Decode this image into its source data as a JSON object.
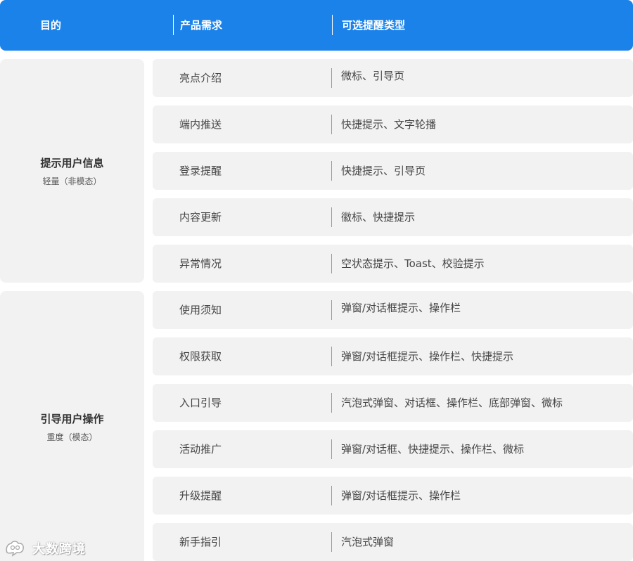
{
  "header": {
    "col1": "目的",
    "col2": "产品需求",
    "col3": "可选提醒类型"
  },
  "groups": [
    {
      "title": "提示用户信息",
      "subtitle": "轻量（非模态）",
      "rows": [
        {
          "need": "亮点介绍",
          "types": "微标、引导页"
        },
        {
          "need": "端内推送",
          "types": "快捷提示、文字轮播"
        },
        {
          "need": "登录提醒",
          "types": "快捷提示、引导页"
        },
        {
          "need": "内容更新",
          "types": "徽标、快捷提示"
        },
        {
          "need": "异常情况",
          "types": "空状态提示、Toast、校验提示"
        }
      ]
    },
    {
      "title": "引导用户操作",
      "subtitle": "重度（模态）",
      "rows": [
        {
          "need": "使用须知",
          "types": "弹窗/对话框提示、操作栏"
        },
        {
          "need": "权限获取",
          "types": "弹窗/对话框提示、操作栏、快捷提示"
        },
        {
          "need": "入口引导",
          "types": "汽泡式弹窗、对话框、操作栏、底部弹窗、微标"
        },
        {
          "need": "活动推广",
          "types": "弹窗/对话框、快捷提示、操作栏、微标"
        },
        {
          "need": "升级提醒",
          "types": "弹窗/对话框提示、操作栏"
        },
        {
          "need": "新手指引",
          "types": "汽泡式弹窗"
        }
      ]
    }
  ],
  "watermark": {
    "text": "大数跨境",
    "icon": "chat-bubbles-logo-icon"
  },
  "colors": {
    "header_bg": "#1b82ea",
    "cell_bg": "#f2f2f2"
  }
}
